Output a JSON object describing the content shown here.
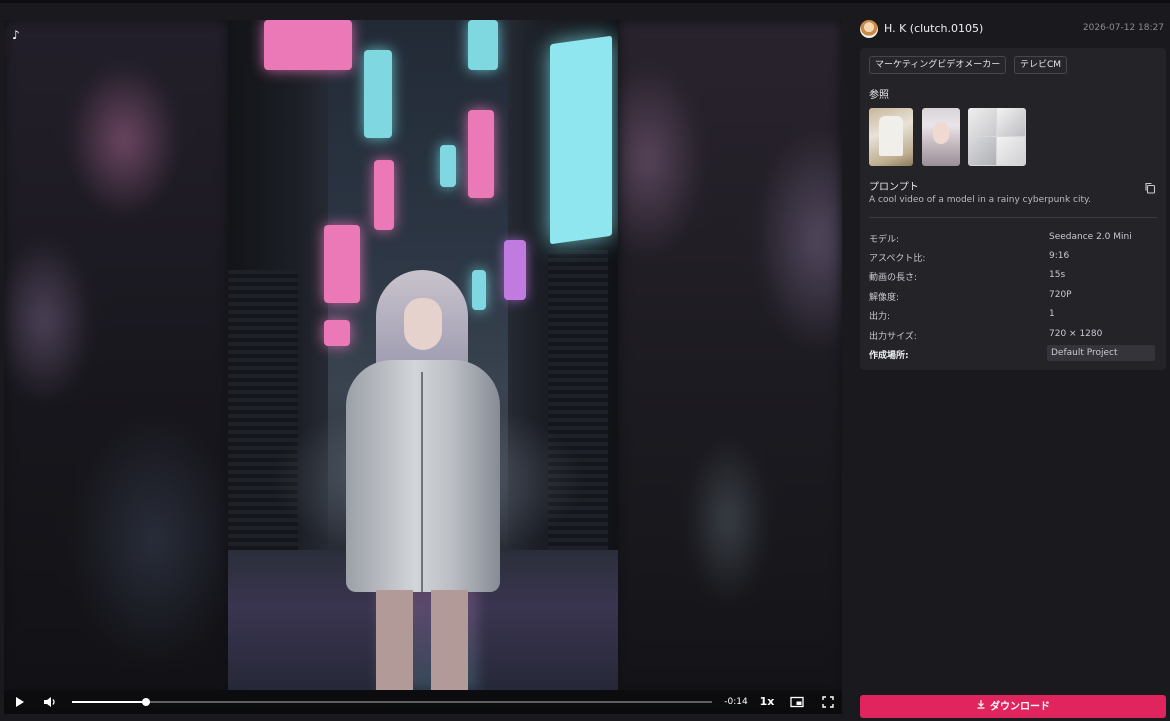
{
  "video": {
    "time_remaining": "-0:14",
    "speed": "1x",
    "progress_fraction": 0.115
  },
  "sidebar": {
    "username": "H. K (clutch.0105)",
    "timestamp": "2026-07-12 18:27",
    "tags": [
      "マーケティングビデオメーカー",
      "テレビCM"
    ],
    "reference_label": "参照",
    "prompt_label": "プロンプト",
    "prompt_text": "A cool video of a model in a rainy cyberpunk city.",
    "details": [
      {
        "key": "モデル:",
        "value": "Seedance 2.0 Mini"
      },
      {
        "key": "アスペクト比:",
        "value": "9:16"
      },
      {
        "key": "動画の長さ:",
        "value": "15s"
      },
      {
        "key": "解像度:",
        "value": "720P"
      },
      {
        "key": "出力:",
        "value": "1"
      },
      {
        "key": "出力サイズ:",
        "value": "720 × 1280"
      }
    ],
    "project_label": "作成場所:",
    "project_value": "Default Project",
    "download_label": "ダウンロード"
  },
  "colors": {
    "accent": "#e0245e",
    "panel": "#232328",
    "background": "#1a1a1e"
  }
}
